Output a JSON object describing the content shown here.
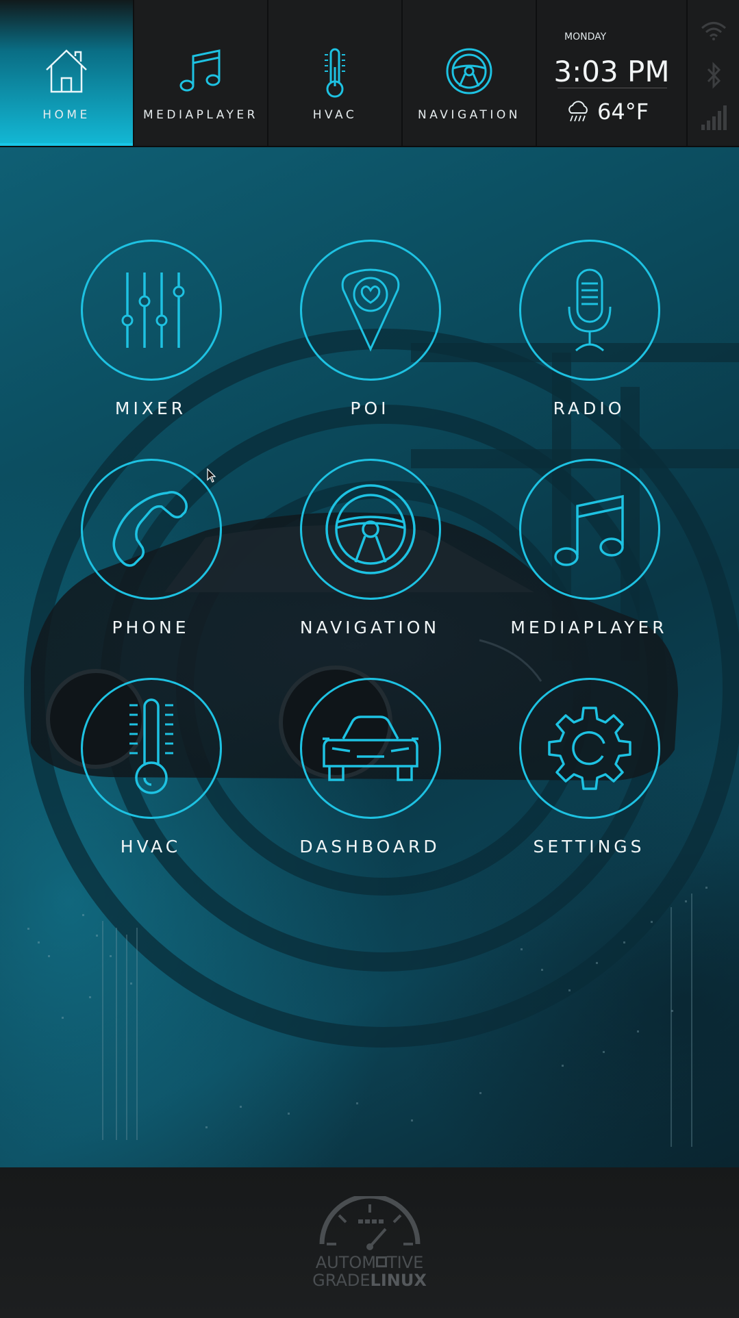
{
  "nav": {
    "tabs": [
      {
        "label": "HOME",
        "icon": "home-icon",
        "active": true
      },
      {
        "label": "MEDIAPLAYER",
        "icon": "music-note-icon",
        "active": false
      },
      {
        "label": "HVAC",
        "icon": "thermometer-icon",
        "active": false
      },
      {
        "label": "NAVIGATION",
        "icon": "steering-wheel-icon",
        "active": false
      }
    ]
  },
  "clock": {
    "day": "MONDAY",
    "time": "3:03 PM",
    "temperature": "64°F",
    "weather_icon": "rain-cloud-icon"
  },
  "status": {
    "icons": [
      "wifi-icon",
      "bluetooth-icon",
      "cellular-signal-icon"
    ]
  },
  "apps": [
    {
      "label": "MIXER",
      "icon": "mixer-sliders-icon"
    },
    {
      "label": "POI",
      "icon": "map-pin-heart-icon"
    },
    {
      "label": "RADIO",
      "icon": "microphone-icon"
    },
    {
      "label": "PHONE",
      "icon": "phone-handset-icon"
    },
    {
      "label": "NAVIGATION",
      "icon": "steering-wheel-icon"
    },
    {
      "label": "MEDIAPLAYER",
      "icon": "music-note-icon"
    },
    {
      "label": "HVAC",
      "icon": "thermometer-icon"
    },
    {
      "label": "DASHBOARD",
      "icon": "car-front-icon"
    },
    {
      "label": "SETTINGS",
      "icon": "gear-icon"
    }
  ],
  "footer": {
    "logo_line1_a": "AUTOM",
    "logo_line1_b": "TIVE",
    "logo_line2_a": "GRADE",
    "logo_line2_b": "LINUX"
  },
  "colors": {
    "accent": "#1ec2e2",
    "topbar": "#1b1c1d",
    "active_tab": "#13b9d6"
  }
}
